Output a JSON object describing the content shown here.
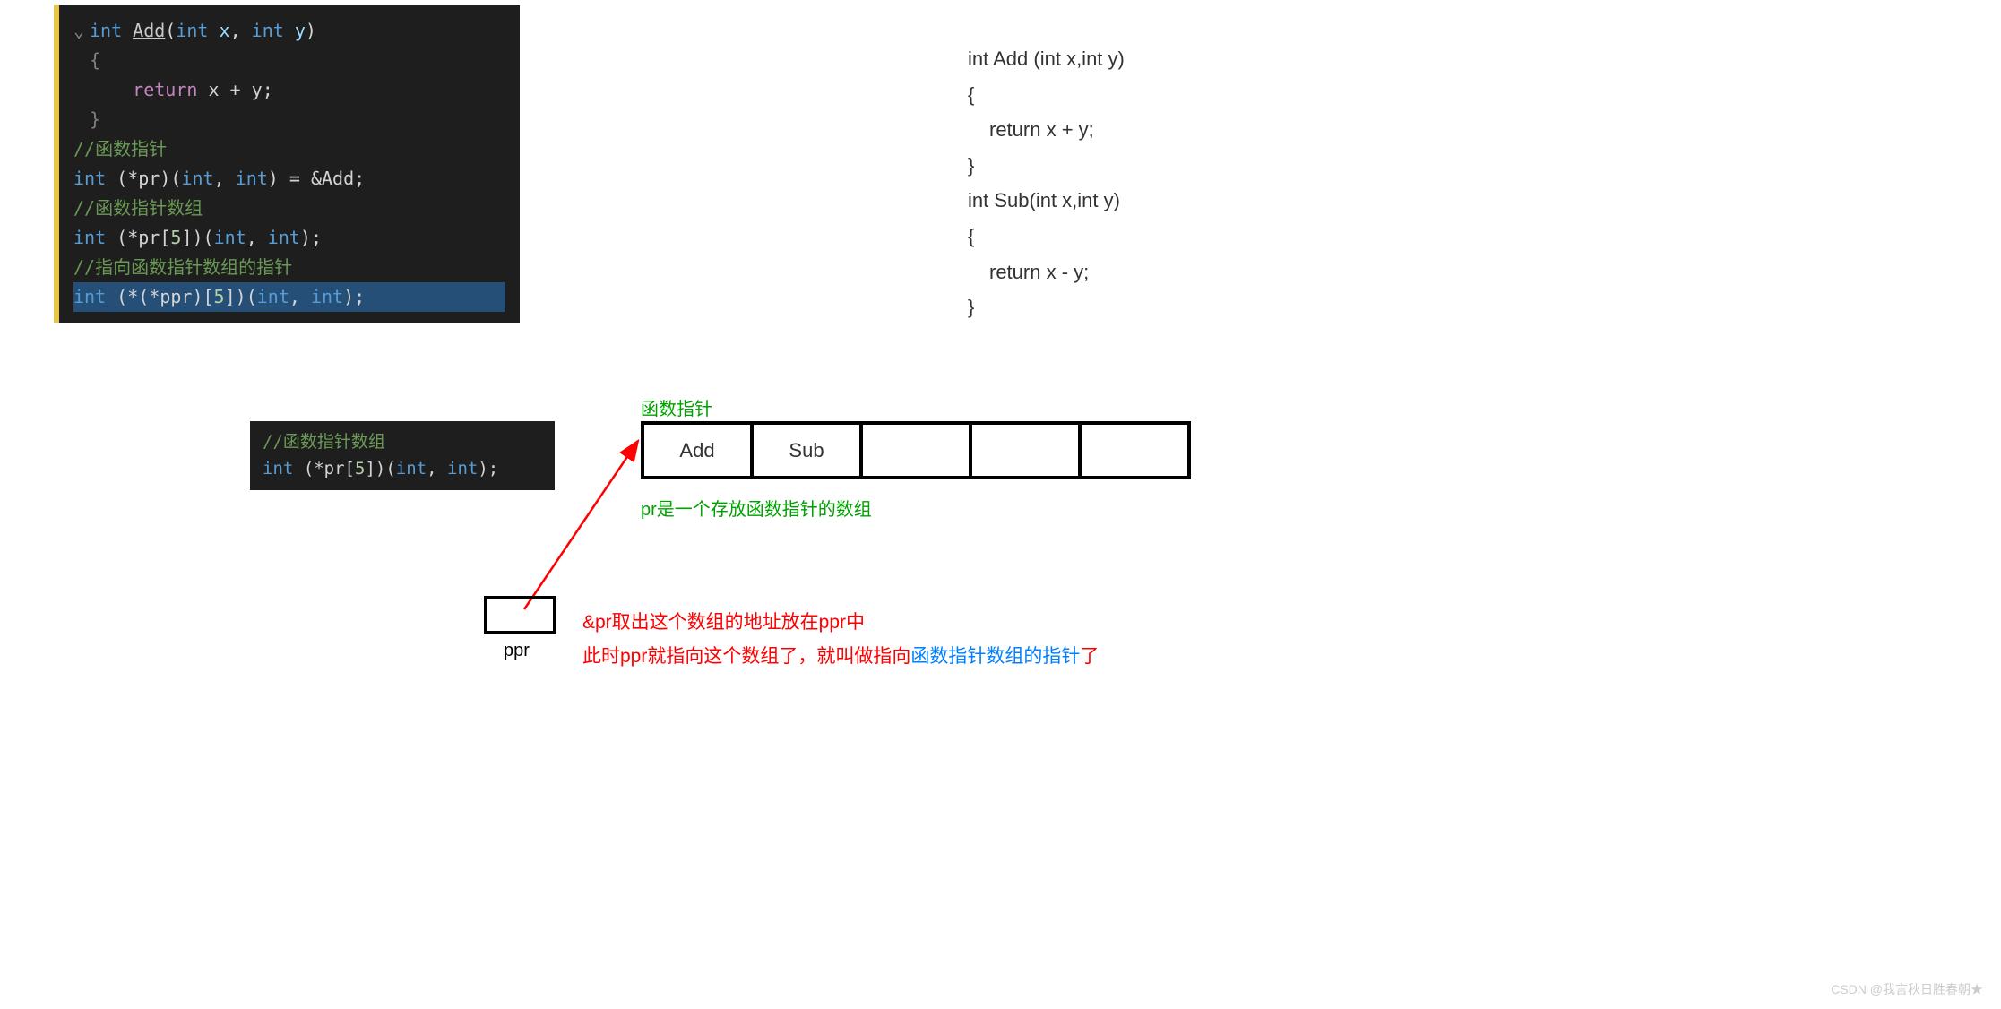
{
  "mainCode": {
    "fnSig": {
      "ret": "int",
      "name": "Add",
      "p1t": "int",
      "p1n": "x",
      "p2t": "int",
      "p2n": "y"
    },
    "retLine": {
      "kw": "return",
      "expr": "x + y"
    },
    "comment1": "//函数指针",
    "line1": {
      "t": "int",
      "pr": "(*pr)",
      "params": "(int, int)",
      "assign": " = &Add;"
    },
    "comment2": "//函数指针数组",
    "line2": {
      "t": "int",
      "pr": "(*pr[5])",
      "params": "(int, int);"
    },
    "comment3": "//指向函数指针数组的指针",
    "line3": {
      "t": "int",
      "pr": "(*(*ppr)[5])",
      "params": "(int, int);"
    }
  },
  "smallCode": {
    "comment": "//函数指针数组",
    "line": {
      "t": "int",
      "pr": "(*pr[5])",
      "params": "(int, int);"
    }
  },
  "plainCode": {
    "l1": "int Add (int x,int y)",
    "l2": "{",
    "l3": "return x + y;",
    "l4": "}",
    "l5": "int Sub(int x,int y)",
    "l6": "{",
    "l7": "return x - y;",
    "l8": "}"
  },
  "labels": {
    "top": "函数指针",
    "arrayCells": [
      "Add",
      "Sub",
      "",
      "",
      ""
    ],
    "bottom": "pr是一个存放函数指针的数组",
    "ppr": "ppr"
  },
  "redText": {
    "line1": "&pr取出这个数组的地址放在ppr中",
    "line2a": "此时ppr就指向这个数组了，就叫做指向",
    "line2b": "函数指针数组的指针",
    "line2c": "了"
  },
  "watermark": "CSDN @我言秋日胜春朝★"
}
